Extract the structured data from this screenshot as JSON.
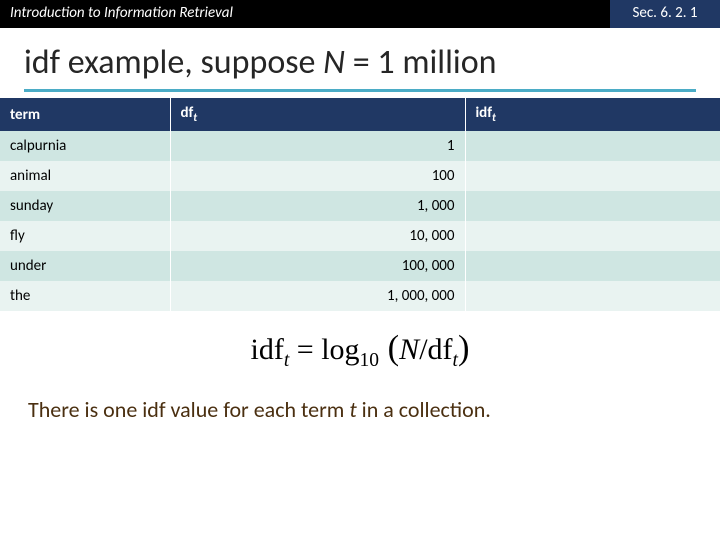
{
  "header": {
    "left": "Introduction to Information Retrieval",
    "right": "Sec. 6. 2. 1"
  },
  "title": {
    "pre": "idf example, suppose ",
    "n": "N",
    "post": " = 1 million"
  },
  "table": {
    "headers": {
      "term": "term",
      "df": "df",
      "df_sub": "t",
      "idf": "idf",
      "idf_sub": "t"
    },
    "rows": [
      {
        "term": "calpurnia",
        "df": "1",
        "idf": ""
      },
      {
        "term": "animal",
        "df": "100",
        "idf": ""
      },
      {
        "term": "sunday",
        "df": "1, 000",
        "idf": ""
      },
      {
        "term": "fly",
        "df": "10, 000",
        "idf": ""
      },
      {
        "term": "under",
        "df": "100, 000",
        "idf": ""
      },
      {
        "term": "the",
        "df": "1, 000, 000",
        "idf": ""
      }
    ]
  },
  "formula": {
    "lhs": "idf",
    "lhs_sub": "t",
    "eq": " = log",
    "log_sub": "10",
    "lp": " (",
    "N": "N",
    "slash": "/",
    "df": "df",
    "df_sub": "t",
    "rp": ")"
  },
  "bottom": {
    "pre": "There is one idf value for each term ",
    "t": "t",
    "post": " in a collection."
  },
  "chart_data": {
    "type": "table",
    "title": "idf example, suppose N = 1 million",
    "columns": [
      "term",
      "df_t",
      "idf_t"
    ],
    "rows": [
      [
        "calpurnia",
        1,
        null
      ],
      [
        "animal",
        100,
        null
      ],
      [
        "sunday",
        1000,
        null
      ],
      [
        "fly",
        10000,
        null
      ],
      [
        "under",
        100000,
        null
      ],
      [
        "the",
        1000000,
        null
      ]
    ],
    "formula": "idf_t = log10(N / df_t)",
    "N": 1000000
  }
}
